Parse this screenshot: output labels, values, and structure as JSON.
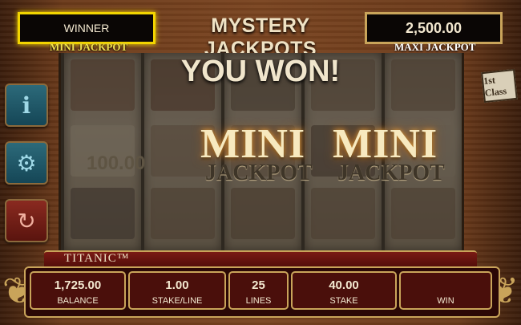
{
  "jackpots": {
    "title": "MYSTERY JACKPOTS",
    "mini_value": "WINNER",
    "mini_label": "MINI JACKPOT",
    "maxi_value": "2,500.00",
    "maxi_label": "MAXI JACKPOT"
  },
  "win": {
    "headline": "YOU WON!",
    "line_amount": "100.00",
    "left_word": "MINI",
    "left_sub": "JACKPOT",
    "right_word": "MINI",
    "right_sub": "JACKPOT"
  },
  "side_buttons": {
    "info_icon": "info-icon",
    "settings_icon": "gear-icon",
    "autoplay_icon": "autoplay-icon"
  },
  "badge": {
    "first_class": "1st Class"
  },
  "brand": {
    "name": "TITANIC™"
  },
  "controls": [
    {
      "value": "1,725.00",
      "label": "BALANCE"
    },
    {
      "value": "1.00",
      "label": "STAKE/LINE"
    },
    {
      "value": "25",
      "label": "LINES"
    },
    {
      "value": "40.00",
      "label": "STAKE"
    },
    {
      "value": "",
      "label": "WIN"
    }
  ]
}
